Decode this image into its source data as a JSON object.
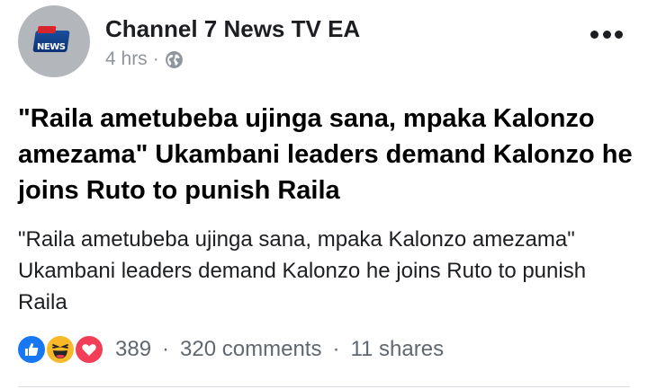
{
  "post": {
    "page_name": "Channel 7 News TV EA",
    "avatar_logo_text": "NEWS",
    "time": "4 hrs",
    "dot": "·",
    "headline": "\"Raila ametubeba ujinga sana, mpaka Kalonzo amezama\" Ukambani leaders demand Kalonzo he joins Ruto to punish Raila",
    "body": "\"Raila ametubeba ujinga sana, mpaka Kalonzo amezama\" Ukambani leaders demand Kalonzo he joins Ruto to punish Raila"
  },
  "engagement": {
    "reaction_icons": [
      "like-icon",
      "haha-icon",
      "love-icon"
    ],
    "reactions_count": "389",
    "comments": "320 comments",
    "shares": "11 shares",
    "separator": "·"
  },
  "colors": {
    "like": "#1877f2",
    "haha": "#f7b928",
    "love": "#f33e58",
    "meta_text": "#90949c"
  }
}
